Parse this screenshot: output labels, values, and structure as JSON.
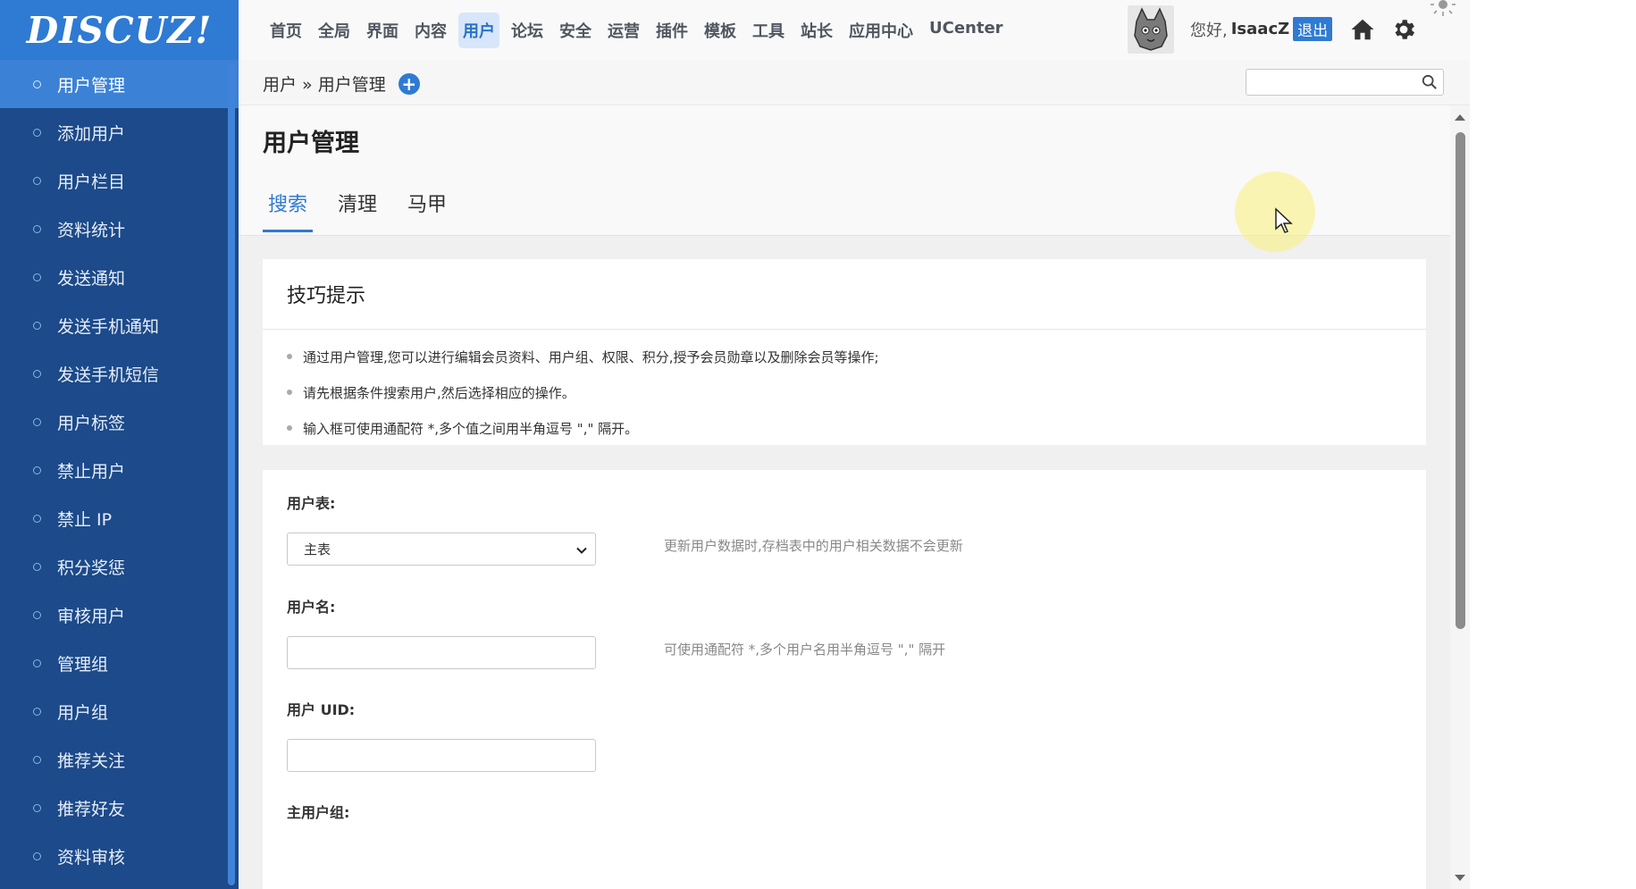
{
  "logo": {
    "text": "DISCUZ!"
  },
  "sidebar": {
    "items": [
      {
        "label": "用户管理",
        "active": true
      },
      {
        "label": "添加用户"
      },
      {
        "label": "用户栏目"
      },
      {
        "label": "资料统计"
      },
      {
        "label": "发送通知"
      },
      {
        "label": "发送手机通知"
      },
      {
        "label": "发送手机短信"
      },
      {
        "label": "用户标签"
      },
      {
        "label": "禁止用户"
      },
      {
        "label": "禁止 IP"
      },
      {
        "label": "积分奖惩"
      },
      {
        "label": "审核用户"
      },
      {
        "label": "管理组"
      },
      {
        "label": "用户组"
      },
      {
        "label": "推荐关注"
      },
      {
        "label": "推荐好友"
      },
      {
        "label": "资料审核"
      }
    ]
  },
  "topnav": {
    "items": [
      {
        "label": "首页"
      },
      {
        "label": "全局"
      },
      {
        "label": "界面"
      },
      {
        "label": "内容"
      },
      {
        "label": "用户",
        "active": true
      },
      {
        "label": "论坛"
      },
      {
        "label": "安全"
      },
      {
        "label": "运营"
      },
      {
        "label": "插件"
      },
      {
        "label": "模板"
      },
      {
        "label": "工具"
      },
      {
        "label": "站长"
      },
      {
        "label": "应用中心"
      },
      {
        "label": "UCenter"
      }
    ],
    "greeting": "您好,",
    "username": "IsaacZ",
    "logout": "退出",
    "icons": [
      "home-icon",
      "gear-icon",
      "sun-icon",
      "moon-icon"
    ]
  },
  "breadcrumb": {
    "text": "用户 » 用户管理",
    "add_icon": "+"
  },
  "search": {
    "placeholder": "",
    "value": ""
  },
  "page": {
    "title": "用户管理",
    "tabs": [
      {
        "label": "搜索",
        "active": true
      },
      {
        "label": "清理"
      },
      {
        "label": "马甲"
      }
    ]
  },
  "tips": {
    "title": "技巧提示",
    "items": [
      "通过用户管理,您可以进行编辑会员资料、用户组、权限、积分,授予会员勋章以及删除会员等操作;",
      "请先根据条件搜索用户,然后选择相应的操作。",
      "输入框可使用通配符 *,多个值之间用半角逗号 \",\" 隔开。"
    ]
  },
  "form": {
    "user_table": {
      "label": "用户表:",
      "value": "主表",
      "hint": "更新用户数据时,存档表中的用户相关数据不会更新"
    },
    "username": {
      "label": "用户名:",
      "value": "",
      "hint": "可使用通配符 *,多个用户名用半角逗号 \",\" 隔开"
    },
    "uid": {
      "label": "用户 UID:",
      "value": ""
    },
    "main_group": {
      "label": "主用户组:"
    }
  },
  "colors": {
    "accent": "#2f7ad3",
    "sidebar_bg": "#1c4a8a",
    "sidebar_active": "#3b82d6"
  }
}
